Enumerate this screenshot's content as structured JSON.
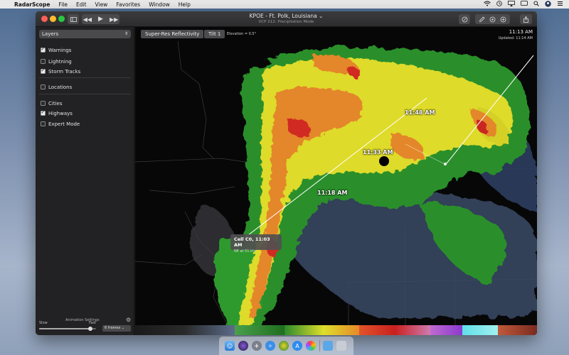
{
  "menubar": {
    "apple": "",
    "app_name": "RadarScope",
    "items": [
      "File",
      "Edit",
      "View",
      "Favorites",
      "Window",
      "Help"
    ],
    "status_icons": [
      "wifi-icon",
      "clock-icon",
      "airplay-icon",
      "display-icon",
      "search-icon",
      "user-icon",
      "menu-icon"
    ]
  },
  "titlebar": {
    "title": "KPOE - Ft. Polk, Louisiana ⌄",
    "subtitle": "VCP 212: Precipitation Mode",
    "controls": [
      "sidebar-toggle-icon",
      "rewind-icon",
      "play-icon",
      "fast-forward-icon"
    ],
    "right_tools": [
      "edit-icon",
      "pencil-icon",
      "settings-icon",
      "plus-icon",
      "share-icon"
    ]
  },
  "sidebar": {
    "layers_label": "Layers",
    "layers": [
      {
        "label": "Warnings",
        "checked": true
      },
      {
        "label": "Lightning",
        "checked": false
      },
      {
        "label": "Storm Tracks",
        "checked": true
      },
      {
        "label": "Locations",
        "checked": false
      },
      {
        "label": "Cities",
        "checked": false
      },
      {
        "label": "Highways",
        "checked": true
      },
      {
        "label": "Expert Mode",
        "checked": false
      }
    ],
    "animation": {
      "title": "Animation Settings",
      "slow": "Slow",
      "fast": "Fast",
      "speed": 0.9,
      "frames": "6 frames ⌄"
    }
  },
  "map": {
    "product": "Super-Res Reflectivity",
    "tilt": "Tilt 1",
    "elevation": "Elevation = 0.5°",
    "time": "11:13 AM",
    "updated": "Updated: 11:14 AM",
    "track_labels": [
      "11:48 AM",
      "11:33 AM",
      "11:18 AM"
    ],
    "cell": {
      "title": "Cell C0, 11:03 AM",
      "sub": "NE at 51 kts"
    }
  },
  "colors": {
    "window_bg": "#1f1f20",
    "sidebar_bg": "#222224",
    "accent_checkbox": "#eaeaea",
    "radar_green": "#2e9a2e",
    "radar_yellow": "#e6e026",
    "radar_orange": "#e88a24",
    "radar_red": "#d12a20"
  },
  "dock": {
    "apps": [
      "finder-icon",
      "siri-icon",
      "launchpad-icon",
      "safari-icon",
      "radarscope-icon",
      "app-store-icon",
      "photos-icon",
      "downloads-icon",
      "trash-icon"
    ]
  }
}
